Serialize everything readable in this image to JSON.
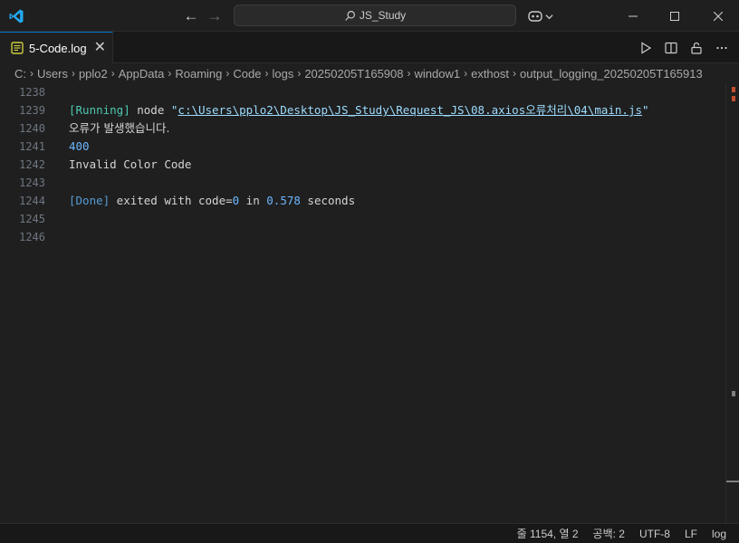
{
  "titlebar": {
    "search_text": "JS_Study"
  },
  "tab": {
    "label": "5-Code.log",
    "close_glyph": "✕"
  },
  "breadcrumb": [
    "C:",
    "Users",
    "pplo2",
    "AppData",
    "Roaming",
    "Code",
    "logs",
    "20250205T165908",
    "window1",
    "exthost",
    "output_logging_20250205T165913"
  ],
  "editor": {
    "lines": [
      {
        "n": "1238",
        "segments": []
      },
      {
        "n": "1239",
        "segments": [
          {
            "t": "[Running]",
            "c": "c-running"
          },
          {
            "t": " node ",
            "c": ""
          },
          {
            "t": "\"",
            "c": "c-quote"
          },
          {
            "t": "c:\\Users\\pplo2\\Desktop\\JS_Study\\Request_JS\\08.axios오류처리\\04\\main.js",
            "c": "c-path"
          },
          {
            "t": "\"",
            "c": "c-quote"
          }
        ]
      },
      {
        "n": "1240",
        "segments": [
          {
            "t": "오류가 발생했습니다.",
            "c": "kor"
          }
        ]
      },
      {
        "n": "1241",
        "segments": [
          {
            "t": "400",
            "c": "c-num"
          }
        ]
      },
      {
        "n": "1242",
        "segments": [
          {
            "t": "Invalid Color Code",
            "c": ""
          }
        ]
      },
      {
        "n": "1243",
        "segments": []
      },
      {
        "n": "1244",
        "segments": [
          {
            "t": "[Done]",
            "c": "c-done"
          },
          {
            "t": " exited with code=",
            "c": ""
          },
          {
            "t": "0",
            "c": "c-num"
          },
          {
            "t": " in ",
            "c": ""
          },
          {
            "t": "0.578",
            "c": "c-num"
          },
          {
            "t": " seconds",
            "c": ""
          }
        ]
      },
      {
        "n": "1245",
        "segments": []
      },
      {
        "n": "1246",
        "segments": []
      }
    ]
  },
  "statusbar": {
    "position": "줄 1154, 열 2",
    "indent": "공백: 2",
    "encoding": "UTF-8",
    "eol": "LF",
    "language": "log"
  },
  "colors": {
    "accent": "#0078d4",
    "background": "#1f1f1f"
  }
}
